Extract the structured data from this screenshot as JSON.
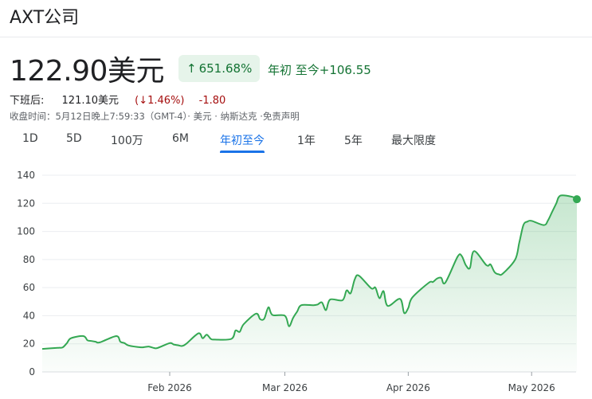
{
  "header": {
    "company_name": "AXT公司"
  },
  "quote": {
    "price": "122.90美元",
    "change_arrow": "↑",
    "change_pct": "651.68%",
    "period_label": "年初 至今",
    "period_change": "+106.55",
    "after_hours_label": "下班后:",
    "after_hours_price": "121.10美元",
    "after_hours_pct": "(↓1.46%)",
    "after_hours_abs": "-1.80",
    "meta": "收盘时间：5月12日晚上7:59:33（GMT-4）· 美元 · 纳斯达克 ·免责声明"
  },
  "tabs": [
    {
      "label": "1D",
      "active": false
    },
    {
      "label": "5D",
      "active": false
    },
    {
      "label": "100万",
      "active": false
    },
    {
      "label": "6M",
      "active": false
    },
    {
      "label": "年初至今",
      "active": true
    },
    {
      "label": "1年",
      "active": false
    },
    {
      "label": "5年",
      "active": false
    },
    {
      "label": "最大限度",
      "active": false
    }
  ],
  "colors": {
    "positive": "#137333",
    "negative": "#a50e0e",
    "line": "#34a853",
    "accent": "#1a73e8"
  },
  "chart_data": {
    "type": "area",
    "title": "",
    "xlabel": "",
    "ylabel": "",
    "ylim": [
      0,
      140
    ],
    "yticks": [
      0,
      20,
      40,
      60,
      80,
      100,
      120,
      140
    ],
    "grid": true,
    "xticks": [
      {
        "label": "Feb 2026",
        "date": "2026-02-02"
      },
      {
        "label": "Mar 2026",
        "date": "2026-03-02"
      },
      {
        "label": "Apr 2026",
        "date": "2026-04-01"
      },
      {
        "label": "May 2026",
        "date": "2026-05-01"
      }
    ],
    "series": [
      {
        "name": "",
        "points": [
          [
            "2026-01-02",
            16.4
          ],
          [
            "2026-01-05",
            17.0
          ],
          [
            "2026-01-06",
            17.2
          ],
          [
            "2026-01-07",
            17.5
          ],
          [
            "2026-01-08",
            20.5
          ],
          [
            "2026-01-09",
            24.0
          ],
          [
            "2026-01-12",
            25.5
          ],
          [
            "2026-01-13",
            22.5
          ],
          [
            "2026-01-14",
            22.0
          ],
          [
            "2026-01-15",
            21.5
          ],
          [
            "2026-01-16",
            21.0
          ],
          [
            "2026-01-20",
            25.5
          ],
          [
            "2026-01-21",
            21.5
          ],
          [
            "2026-01-22",
            20.5
          ],
          [
            "2026-01-23",
            18.8
          ],
          [
            "2026-01-26",
            17.5
          ],
          [
            "2026-01-27",
            17.8
          ],
          [
            "2026-01-28",
            18.0
          ],
          [
            "2026-01-29",
            17.2
          ],
          [
            "2026-01-30",
            17.0
          ],
          [
            "2026-02-02",
            20.5
          ],
          [
            "2026-02-03",
            19.5
          ],
          [
            "2026-02-04",
            19.0
          ],
          [
            "2026-02-05",
            18.5
          ],
          [
            "2026-02-06",
            20.0
          ],
          [
            "2026-02-09",
            27.5
          ],
          [
            "2026-02-10",
            24.0
          ],
          [
            "2026-02-11",
            26.5
          ],
          [
            "2026-02-12",
            23.5
          ],
          [
            "2026-02-13",
            23.0
          ],
          [
            "2026-02-17",
            23.5
          ],
          [
            "2026-02-18",
            29.5
          ],
          [
            "2026-02-19",
            28.5
          ],
          [
            "2026-02-20",
            34.0
          ],
          [
            "2026-02-23",
            41.5
          ],
          [
            "2026-02-24",
            37.5
          ],
          [
            "2026-02-25",
            38.0
          ],
          [
            "2026-02-26",
            46.0
          ],
          [
            "2026-02-27",
            40.5
          ],
          [
            "2026-03-02",
            40.0
          ],
          [
            "2026-03-03",
            32.5
          ],
          [
            "2026-03-04",
            38.5
          ],
          [
            "2026-03-05",
            43.0
          ],
          [
            "2026-03-06",
            47.5
          ],
          [
            "2026-03-09",
            47.5
          ],
          [
            "2026-03-10",
            48.0
          ],
          [
            "2026-03-11",
            49.5
          ],
          [
            "2026-03-12",
            44.0
          ],
          [
            "2026-03-13",
            51.5
          ],
          [
            "2026-03-16",
            51.0
          ],
          [
            "2026-03-17",
            58.0
          ],
          [
            "2026-03-18",
            56.0
          ],
          [
            "2026-03-19",
            66.0
          ],
          [
            "2026-03-20",
            68.5
          ],
          [
            "2026-03-23",
            59.5
          ],
          [
            "2026-03-24",
            60.0
          ],
          [
            "2026-03-25",
            52.5
          ],
          [
            "2026-03-26",
            57.5
          ],
          [
            "2026-03-27",
            47.0
          ],
          [
            "2026-03-30",
            52.0
          ],
          [
            "2026-03-31",
            42.0
          ],
          [
            "2026-04-01",
            45.5
          ],
          [
            "2026-04-02",
            53.0
          ],
          [
            "2026-04-06",
            63.5
          ],
          [
            "2026-04-07",
            64.0
          ],
          [
            "2026-04-08",
            66.5
          ],
          [
            "2026-04-09",
            67.0
          ],
          [
            "2026-04-10",
            63.5
          ],
          [
            "2026-04-13",
            82.0
          ],
          [
            "2026-04-14",
            82.5
          ],
          [
            "2026-04-15",
            76.0
          ],
          [
            "2026-04-16",
            74.0
          ],
          [
            "2026-04-17",
            86.0
          ],
          [
            "2026-04-20",
            76.0
          ],
          [
            "2026-04-21",
            76.5
          ],
          [
            "2026-04-22",
            71.0
          ],
          [
            "2026-04-23",
            69.5
          ],
          [
            "2026-04-24",
            70.0
          ],
          [
            "2026-04-27",
            80.0
          ],
          [
            "2026-04-28",
            92.0
          ],
          [
            "2026-04-29",
            104.5
          ],
          [
            "2026-04-30",
            107.0
          ],
          [
            "2026-05-01",
            107.5
          ],
          [
            "2026-05-04",
            104.5
          ],
          [
            "2026-05-05",
            108.0
          ],
          [
            "2026-05-06",
            114.0
          ],
          [
            "2026-05-07",
            120.0
          ],
          [
            "2026-05-08",
            125.5
          ],
          [
            "2026-05-11",
            124.5
          ],
          [
            "2026-05-12",
            122.9
          ]
        ]
      }
    ]
  }
}
